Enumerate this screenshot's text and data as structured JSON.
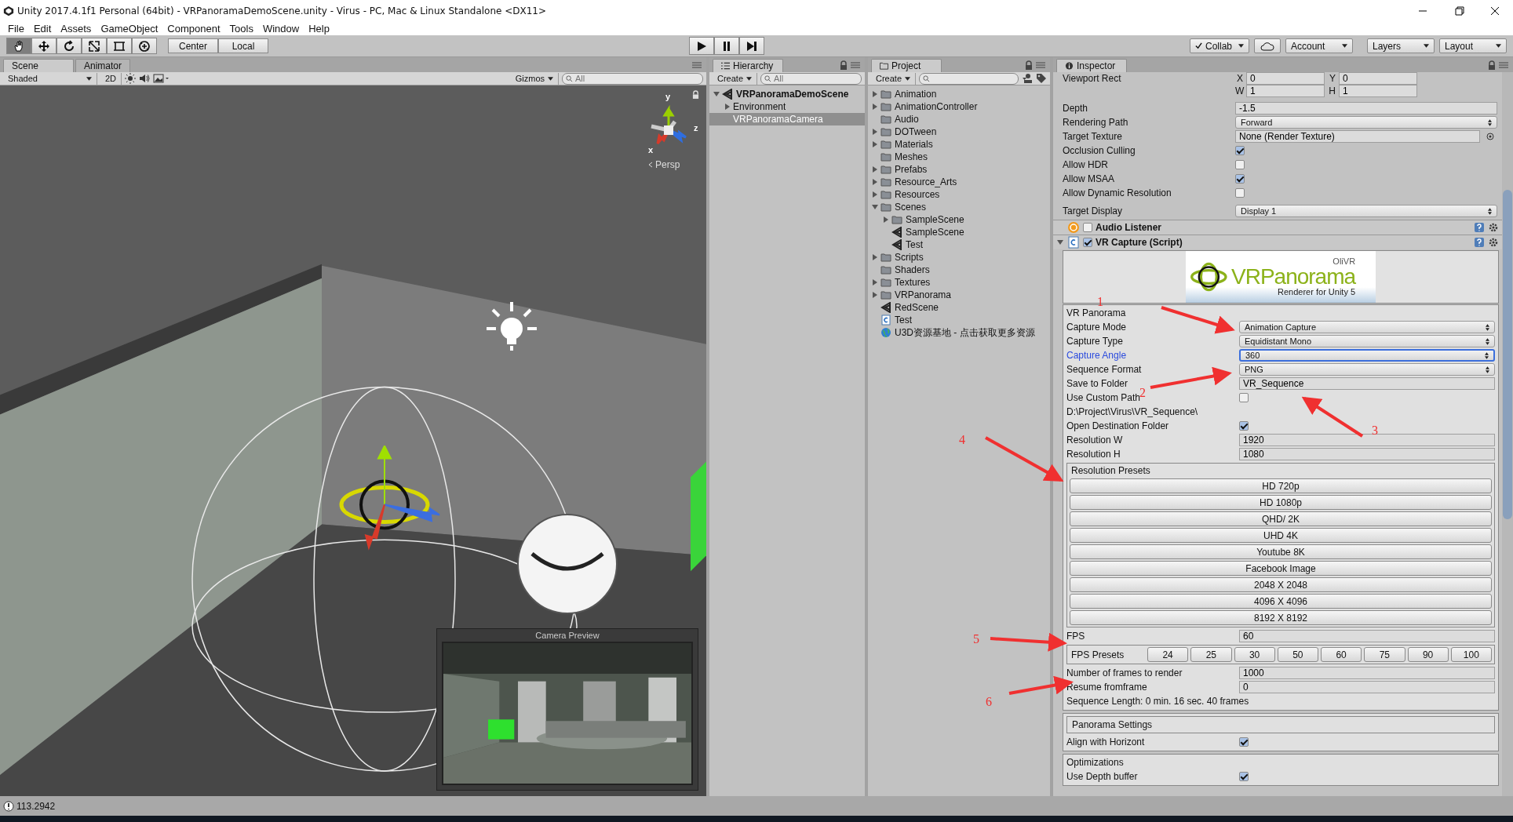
{
  "window": {
    "title": "Unity 2017.4.1f1 Personal (64bit) - VRPanoramaDemoScene.unity - Virus - PC, Mac & Linux Standalone <DX11>"
  },
  "menu": [
    "File",
    "Edit",
    "Assets",
    "GameObject",
    "Component",
    "Tools",
    "Window",
    "Help"
  ],
  "toolbar": {
    "tools": [
      {
        "kind": "hand",
        "selected": true
      },
      {
        "kind": "move",
        "selected": false
      },
      {
        "kind": "rotate",
        "selected": false
      },
      {
        "kind": "scale",
        "selected": false
      },
      {
        "kind": "rect",
        "selected": false
      },
      {
        "kind": "transform",
        "selected": false
      }
    ],
    "pivot": [
      "Center",
      "Local"
    ],
    "playback": [
      {
        "kind": "play"
      },
      {
        "kind": "pause"
      },
      {
        "kind": "step"
      }
    ],
    "collab": "Collab",
    "account": "Account",
    "layers": "Layers",
    "layout": "Layout"
  },
  "scene": {
    "tabs": [
      {
        "label": "Scene",
        "selected": true
      },
      {
        "label": "Animator",
        "selected": false
      }
    ],
    "shading": "Shaded",
    "mode_2d": "2D",
    "gizmos": "Gizmos",
    "search": {
      "placeholder": "All"
    },
    "axes": [
      "y",
      "x",
      "z"
    ],
    "projection": "Persp",
    "preview": {
      "title": "Camera Preview"
    }
  },
  "hierarchy": {
    "tab": "Hierarchy",
    "create": "Create",
    "search": {
      "placeholder": "All"
    },
    "items": [
      {
        "label": "VRPanoramaDemoScene",
        "kind": "scene",
        "expanded": true,
        "selected": false,
        "children": [
          {
            "label": "Environment",
            "expanded": false,
            "selected": false
          },
          {
            "label": "VRPanoramaCamera",
            "selected": true
          }
        ]
      }
    ]
  },
  "project": {
    "tab": "Project",
    "create": "Create",
    "items": [
      {
        "label": "Animation",
        "kind": "folder",
        "expanded": false
      },
      {
        "label": "AnimationController",
        "kind": "folder",
        "expanded": false
      },
      {
        "label": "Audio",
        "kind": "folder"
      },
      {
        "label": "DOTween",
        "kind": "folder",
        "expanded": false
      },
      {
        "label": "Materials",
        "kind": "folder",
        "expanded": false
      },
      {
        "label": "Meshes",
        "kind": "folder"
      },
      {
        "label": "Prefabs",
        "kind": "folder",
        "expanded": false
      },
      {
        "label": "Resource_Arts",
        "kind": "folder",
        "expanded": false
      },
      {
        "label": "Resources",
        "kind": "folder",
        "expanded": false
      },
      {
        "label": "Scenes",
        "kind": "folder",
        "expanded": true,
        "children": [
          {
            "label": "SampleScene",
            "kind": "folder",
            "expanded": false
          },
          {
            "label": "SampleScene",
            "kind": "scene"
          },
          {
            "label": "Test",
            "kind": "scene"
          }
        ]
      },
      {
        "label": "Scripts",
        "kind": "folder",
        "expanded": false
      },
      {
        "label": "Shaders",
        "kind": "folder"
      },
      {
        "label": "Textures",
        "kind": "folder",
        "expanded": false
      },
      {
        "label": "VRPanorama",
        "kind": "folder",
        "expanded": false
      },
      {
        "label": "RedScene",
        "kind": "scene"
      },
      {
        "label": "Test",
        "kind": "script"
      },
      {
        "label": "U3D资源基地 - 点击获取更多资源",
        "kind": "link"
      }
    ]
  },
  "inspector": {
    "tab": "Inspector",
    "camera_rows": [
      {
        "kind": "vec2",
        "label": "Viewport Rect",
        "fields": [
          {
            "axis": "X",
            "value": "0"
          },
          {
            "axis": "Y",
            "value": "0"
          }
        ]
      },
      {
        "kind": "vec2",
        "fields": [
          {
            "axis": "W",
            "value": "1"
          },
          {
            "axis": "H",
            "value": "1"
          }
        ]
      },
      {
        "kind": "text",
        "label": "Depth",
        "value": "-1.5"
      },
      {
        "kind": "dropdown",
        "label": "Rendering Path",
        "value": "Forward"
      },
      {
        "kind": "object",
        "label": "Target Texture",
        "value": "None (Render Texture)"
      },
      {
        "kind": "checkbox",
        "label": "Occlusion Culling",
        "checked": true
      },
      {
        "kind": "checkbox",
        "label": "Allow HDR",
        "checked": false
      },
      {
        "kind": "checkbox",
        "label": "Allow MSAA",
        "checked": true
      },
      {
        "kind": "checkbox",
        "label": "Allow Dynamic Resolution",
        "checked": false
      },
      {
        "kind": "dropdown",
        "label": "Target Display",
        "value": "Display 1"
      }
    ],
    "components": [
      {
        "title": "Audio Listener",
        "kind": "audio",
        "enabled": false
      },
      {
        "title": "VR Capture (Script)",
        "kind": "script",
        "enabled": true,
        "expanded": true
      }
    ],
    "logo": {
      "brand": "OliVR",
      "name": "VRPanorama",
      "tagline": "Renderer for Unity 5"
    },
    "capture_rows": [
      {
        "kind": "info",
        "label": "VR Panorama"
      },
      {
        "kind": "dropdown",
        "label": "Capture Mode",
        "value": "Animation Capture",
        "focused": false
      },
      {
        "kind": "dropdown",
        "label": "Capture Type",
        "value": "Equidistant Mono",
        "focused": false
      },
      {
        "kind": "dropdown",
        "label": "Capture Angle",
        "value": "360",
        "focused": true
      },
      {
        "kind": "dropdown",
        "label": "Sequence Format",
        "value": "PNG",
        "focused": false
      },
      {
        "kind": "text",
        "label": "Save to Folder",
        "value": "VR_Sequence"
      },
      {
        "kind": "checkbox",
        "label": "Use Custom Path",
        "checked": false
      },
      {
        "kind": "info",
        "label": "D:\\Project\\Virus\\VR_Sequence\\"
      },
      {
        "kind": "checkbox",
        "label": "Open Destination Folder",
        "checked": true
      },
      {
        "kind": "text",
        "label": "Resolution W",
        "value": "1920"
      },
      {
        "kind": "text",
        "label": "Resolution H",
        "value": "1080"
      },
      {
        "kind": "preset-list",
        "label": "Resolution Presets",
        "buttons": [
          "HD 720p",
          "HD 1080p",
          "QHD/ 2K",
          "UHD 4K",
          "Youtube 8K",
          "Facebook Image",
          "2048 X 2048",
          "4096 X 4096",
          "8192 X 8192"
        ]
      },
      {
        "kind": "text",
        "label": "FPS",
        "value": "60"
      },
      {
        "kind": "preset-row",
        "label": "FPS Presets",
        "buttons": [
          "24",
          "25",
          "30",
          "50",
          "60",
          "75",
          "90",
          "100"
        ]
      },
      {
        "kind": "text",
        "label": "Number of frames to render",
        "value": "1000"
      },
      {
        "kind": "text",
        "label": "Resume fromframe",
        "value": "0"
      },
      {
        "kind": "info",
        "label": "Sequence Length: 0 min. 16 sec. 40 frames"
      }
    ],
    "panorama_rows": [
      {
        "kind": "heading",
        "label": "Panorama Settings"
      },
      {
        "kind": "checkbox",
        "label": "Align with Horizont",
        "checked": true
      }
    ],
    "optimization_rows": [
      {
        "kind": "info",
        "label": "Optimizations"
      },
      {
        "kind": "checkbox",
        "label": "Use Depth buffer",
        "checked": true
      }
    ]
  },
  "status_bar": {
    "text": "113.2942"
  },
  "annotations": [
    "1",
    "2",
    "3",
    "4",
    "5",
    "6"
  ]
}
